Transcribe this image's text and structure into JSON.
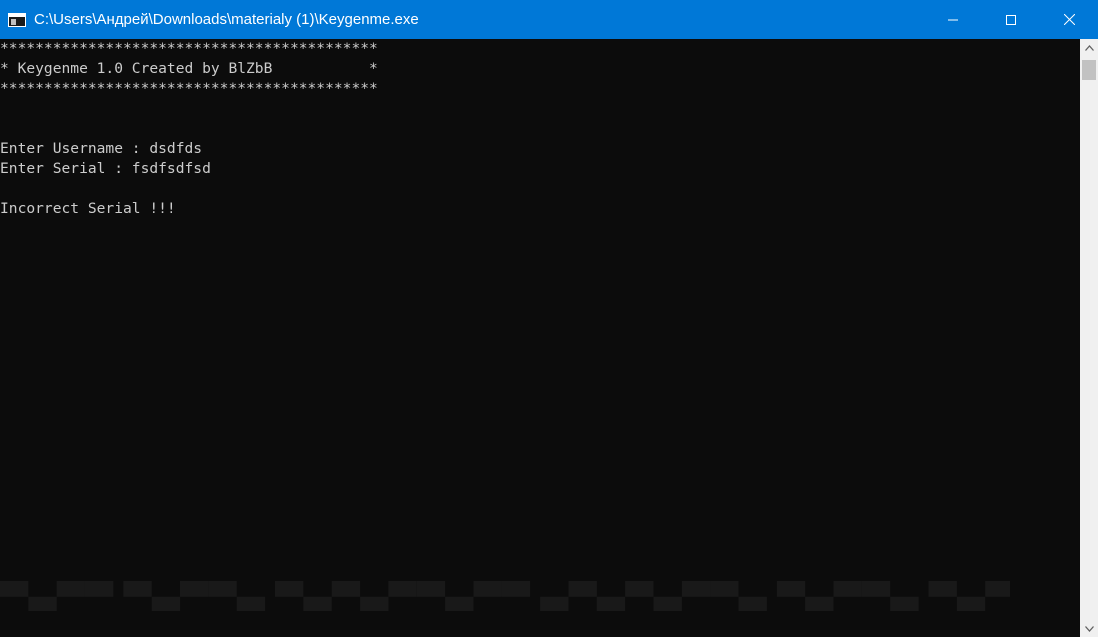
{
  "window": {
    "title": "C:\\Users\\Андрей\\Downloads\\materialy (1)\\Keygenme.exe",
    "icon": "console-app-icon",
    "buttons": {
      "minimize": "minimize-icon",
      "maximize": "maximize-icon",
      "close": "close-icon"
    },
    "colors": {
      "titlebar": "#0078d7",
      "console_bg": "#0c0c0c",
      "console_text": "#cccccc",
      "scrollbar_track": "#f0f0f0",
      "scrollbar_thumb": "#c2c2c2"
    }
  },
  "console": {
    "lines": [
      "*******************************************",
      "* Keygenme 1.0 Created by BlZbB           *",
      "*******************************************",
      "",
      "",
      "Enter Username : dsdfds",
      "Enter Serial : fsdfsdfsd",
      "",
      "Incorrect Serial !!!"
    ]
  },
  "scrollbar": {
    "up": "scroll-up-arrow-icon",
    "down": "scroll-down-arrow-icon"
  }
}
